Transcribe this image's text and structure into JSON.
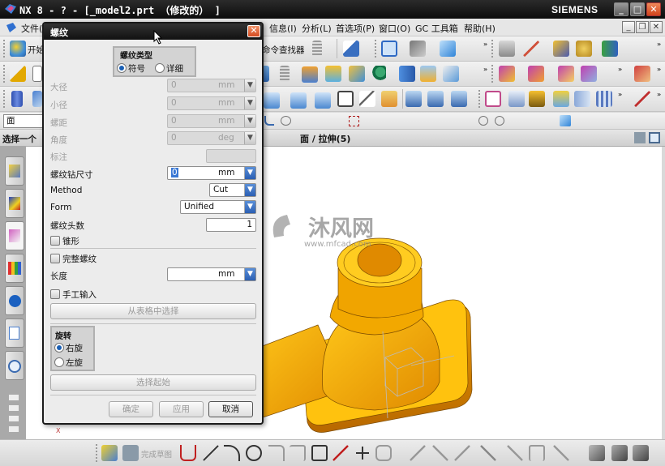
{
  "window": {
    "title": "NX 8 - ? - [_model2.prt （修改的） ]",
    "brand": "SIEMENS",
    "controls": {
      "minimize": "_",
      "maximize": "□",
      "close": "✕"
    }
  },
  "menubar": {
    "items": [
      {
        "label": "文件(F)"
      },
      {
        "label": "信息(I)"
      },
      {
        "label": "分析(L)"
      },
      {
        "label": "首选项(P)"
      },
      {
        "label": "窗口(O)"
      },
      {
        "label": "GC 工具箱"
      },
      {
        "label": "帮助(H)"
      }
    ],
    "mdi": {
      "minimize": "_",
      "restore": "❐",
      "close": "✕"
    }
  },
  "toolbar": {
    "start_label": "开始",
    "command_finder_label": "命令查找器",
    "overflow": "»"
  },
  "filter": {
    "value": "面"
  },
  "status": {
    "prompt": "选择一个",
    "selection": "面 / 拉伸(5)"
  },
  "dialog": {
    "title": "螺纹",
    "thread_type": {
      "group_label": "螺纹类型",
      "options": [
        {
          "label": "符号",
          "selected": true
        },
        {
          "label": "详细",
          "selected": false
        }
      ]
    },
    "fields": {
      "major_diameter": {
        "label": "大径",
        "value": "0",
        "unit": "mm",
        "enabled": false
      },
      "minor_diameter": {
        "label": "小径",
        "value": "0",
        "unit": "mm",
        "enabled": false
      },
      "pitch": {
        "label": "螺距",
        "value": "0",
        "unit": "mm",
        "enabled": false
      },
      "angle": {
        "label": "角度",
        "value": "0",
        "unit": "deg",
        "enabled": false
      },
      "callout": {
        "label": "标注",
        "value": "",
        "enabled": false
      },
      "drill_size": {
        "label": "螺纹钻尺寸",
        "value": "0",
        "unit": "mm",
        "enabled": true
      },
      "method": {
        "label": "Method",
        "value": "Cut"
      },
      "form": {
        "label": "Form",
        "value": "Unified"
      },
      "starts": {
        "label": "螺纹头数",
        "value": "1"
      },
      "tapered": {
        "label": "锥形",
        "checked": false
      },
      "full_thread": {
        "label": "完整螺纹",
        "checked": false
      },
      "length": {
        "label": "长度",
        "value": "",
        "unit": "mm"
      },
      "manual_input": {
        "label": "手工输入",
        "checked": false
      }
    },
    "choose_from_table_label": "从表格中选择",
    "rotation": {
      "group_label": "旋转",
      "options": [
        {
          "label": "右旋",
          "selected": true
        },
        {
          "label": "左旋",
          "selected": false
        }
      ]
    },
    "select_start_label": "选择起始",
    "buttons": {
      "ok": "确定",
      "apply": "应用",
      "cancel": "取消"
    }
  },
  "watermark": {
    "brand": "沐风网",
    "url": "www.mfcad.com"
  },
  "bottom_toolbar": {
    "finish_sketch_label": "完成草图"
  },
  "axis_label": "X"
}
